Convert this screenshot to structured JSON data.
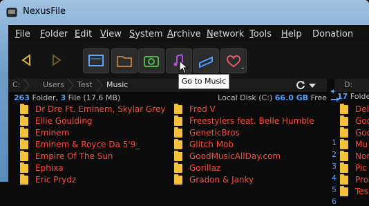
{
  "window": {
    "title": "NexusFile"
  },
  "menu": [
    {
      "label": "File",
      "u": "F",
      "rest": "ile"
    },
    {
      "label": "Folder",
      "u": "F",
      "rest": "older"
    },
    {
      "label": "Edit",
      "u": "E",
      "rest": "dit"
    },
    {
      "label": "View",
      "u": "V",
      "rest": "iew"
    },
    {
      "label": "System",
      "u": "S",
      "rest": "ystem"
    },
    {
      "label": "Archive",
      "u": "A",
      "rest": "rchive"
    },
    {
      "label": "Network",
      "u": "N",
      "rest": "etwork"
    },
    {
      "label": "Tools",
      "u": "T",
      "rest": "ools"
    },
    {
      "label": "Help",
      "u": "H",
      "rest": "elp"
    },
    {
      "label": "Donation",
      "u": "",
      "rest": "Donation"
    }
  ],
  "toolbar": {
    "icons": [
      "back-icon",
      "forward-icon",
      "console-icon",
      "folder-icon",
      "camera-icon",
      "music-icon",
      "drive-icon",
      "favorites-icon"
    ]
  },
  "tooltip": "Go to Music",
  "path": {
    "drive": "C:",
    "crumbs": [
      "Users",
      "Test",
      "Music"
    ]
  },
  "left_info": {
    "folders": "263",
    "folder_word": "Folder,",
    "files": "3",
    "file_word": "File",
    "size": "(17.6 MB)",
    "disk_label": "Local Disk (C:)",
    "free": "66.0 GB",
    "free_word": "Free"
  },
  "middle": {
    "numbers": [
      "1",
      "2",
      "3",
      "4",
      "5",
      "6"
    ]
  },
  "right_pane": {
    "drive": "D:",
    "folders": "17",
    "folder_word": "Folde",
    "items": [
      "Del",
      "Goo",
      "Goo",
      "Mu",
      "Nor",
      "Pic",
      "Pro",
      "Tes"
    ]
  },
  "list_left": [
    "Dr Dre Ft. Eminem, Skylar Grey",
    "Ellie Goulding",
    "Eminem",
    "Eminem & Royce Da 5'9_",
    "Empire Of The Sun",
    "Ephixa",
    "Eric Prydz"
  ],
  "list_right": [
    "Fred V",
    "Freestylers feat. Belle Humble",
    "GeneticBros",
    "Glitch Mob",
    "GoodMusicAllDay.com",
    "Gorillaz",
    "Gradon & Janky"
  ]
}
